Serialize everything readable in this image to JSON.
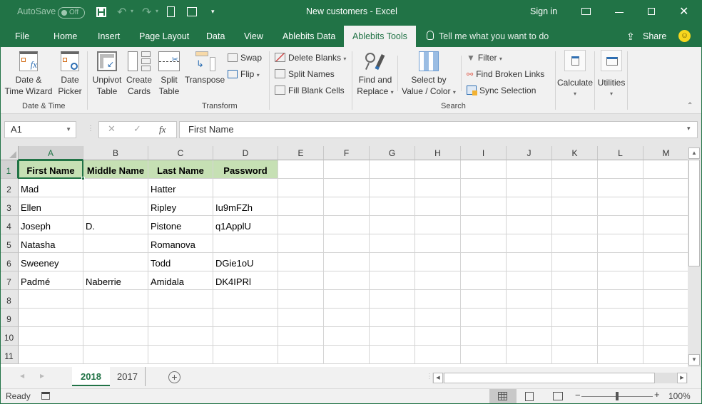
{
  "titlebar": {
    "autosave_label": "AutoSave",
    "autosave_state": "Off",
    "title": "New customers",
    "separator": "-",
    "app": "Excel",
    "sign_in": "Sign in"
  },
  "menu_tabs": [
    "File",
    "Home",
    "Insert",
    "Page Layout",
    "Data",
    "View",
    "Ablebits Data",
    "Ablebits Tools"
  ],
  "active_tab": "Ablebits Tools",
  "tell_me": "Tell me what you want to do",
  "share": "Share",
  "ribbon": {
    "groups": {
      "date_time": "Date & Time",
      "transform": "Transform",
      "search": "Search"
    },
    "date_time_wizard": [
      "Date &",
      "Time Wizard"
    ],
    "date_picker": [
      "Date",
      "Picker"
    ],
    "unpivot_table": [
      "Unpivot",
      "Table"
    ],
    "create_cards": [
      "Create",
      "Cards"
    ],
    "split_table": [
      "Split",
      "Table"
    ],
    "transpose": "Transpose",
    "swap": "Swap",
    "flip": "Flip",
    "delete_blanks": "Delete Blanks",
    "split_names": "Split Names",
    "fill_blank_cells": "Fill Blank Cells",
    "find_replace": [
      "Find and",
      "Replace"
    ],
    "select_by": [
      "Select by",
      "Value / Color"
    ],
    "filter": "Filter",
    "find_broken_links": "Find Broken Links",
    "sync_selection": "Sync Selection",
    "calculate": "Calculate",
    "utilities": "Utilities"
  },
  "formula_bar": {
    "name_box": "A1",
    "fx": "fx",
    "value": "First Name"
  },
  "columns": [
    "A",
    "B",
    "C",
    "D",
    "E",
    "F",
    "G",
    "H",
    "I",
    "J",
    "K",
    "L",
    "M"
  ],
  "rows": [
    "1",
    "2",
    "3",
    "4",
    "5",
    "6",
    "7",
    "8",
    "9",
    "10",
    "11"
  ],
  "table": {
    "headers": [
      "First Name",
      "Middle Name",
      "Last Name",
      "Password"
    ],
    "data": [
      [
        "Mad",
        "",
        "Hatter",
        ""
      ],
      [
        "Ellen",
        "",
        "Ripley",
        "Iu9mFZh"
      ],
      [
        "Joseph",
        "D.",
        "Pistone",
        "q1ApplU"
      ],
      [
        "Natasha",
        "",
        "Romanova",
        ""
      ],
      [
        "Sweeney",
        "",
        "Todd",
        "DGie1oU"
      ],
      [
        "Padmé",
        "Naberrie",
        "Amidala",
        "DK4IPRl"
      ]
    ]
  },
  "sheets": [
    "2018",
    "2017"
  ],
  "active_sheet": "2018",
  "status": {
    "ready": "Ready",
    "zoom": "100%",
    "zoom_level_percent": 100
  },
  "colors": {
    "brand": "#217346",
    "header_fill": "#c6e0b4"
  }
}
